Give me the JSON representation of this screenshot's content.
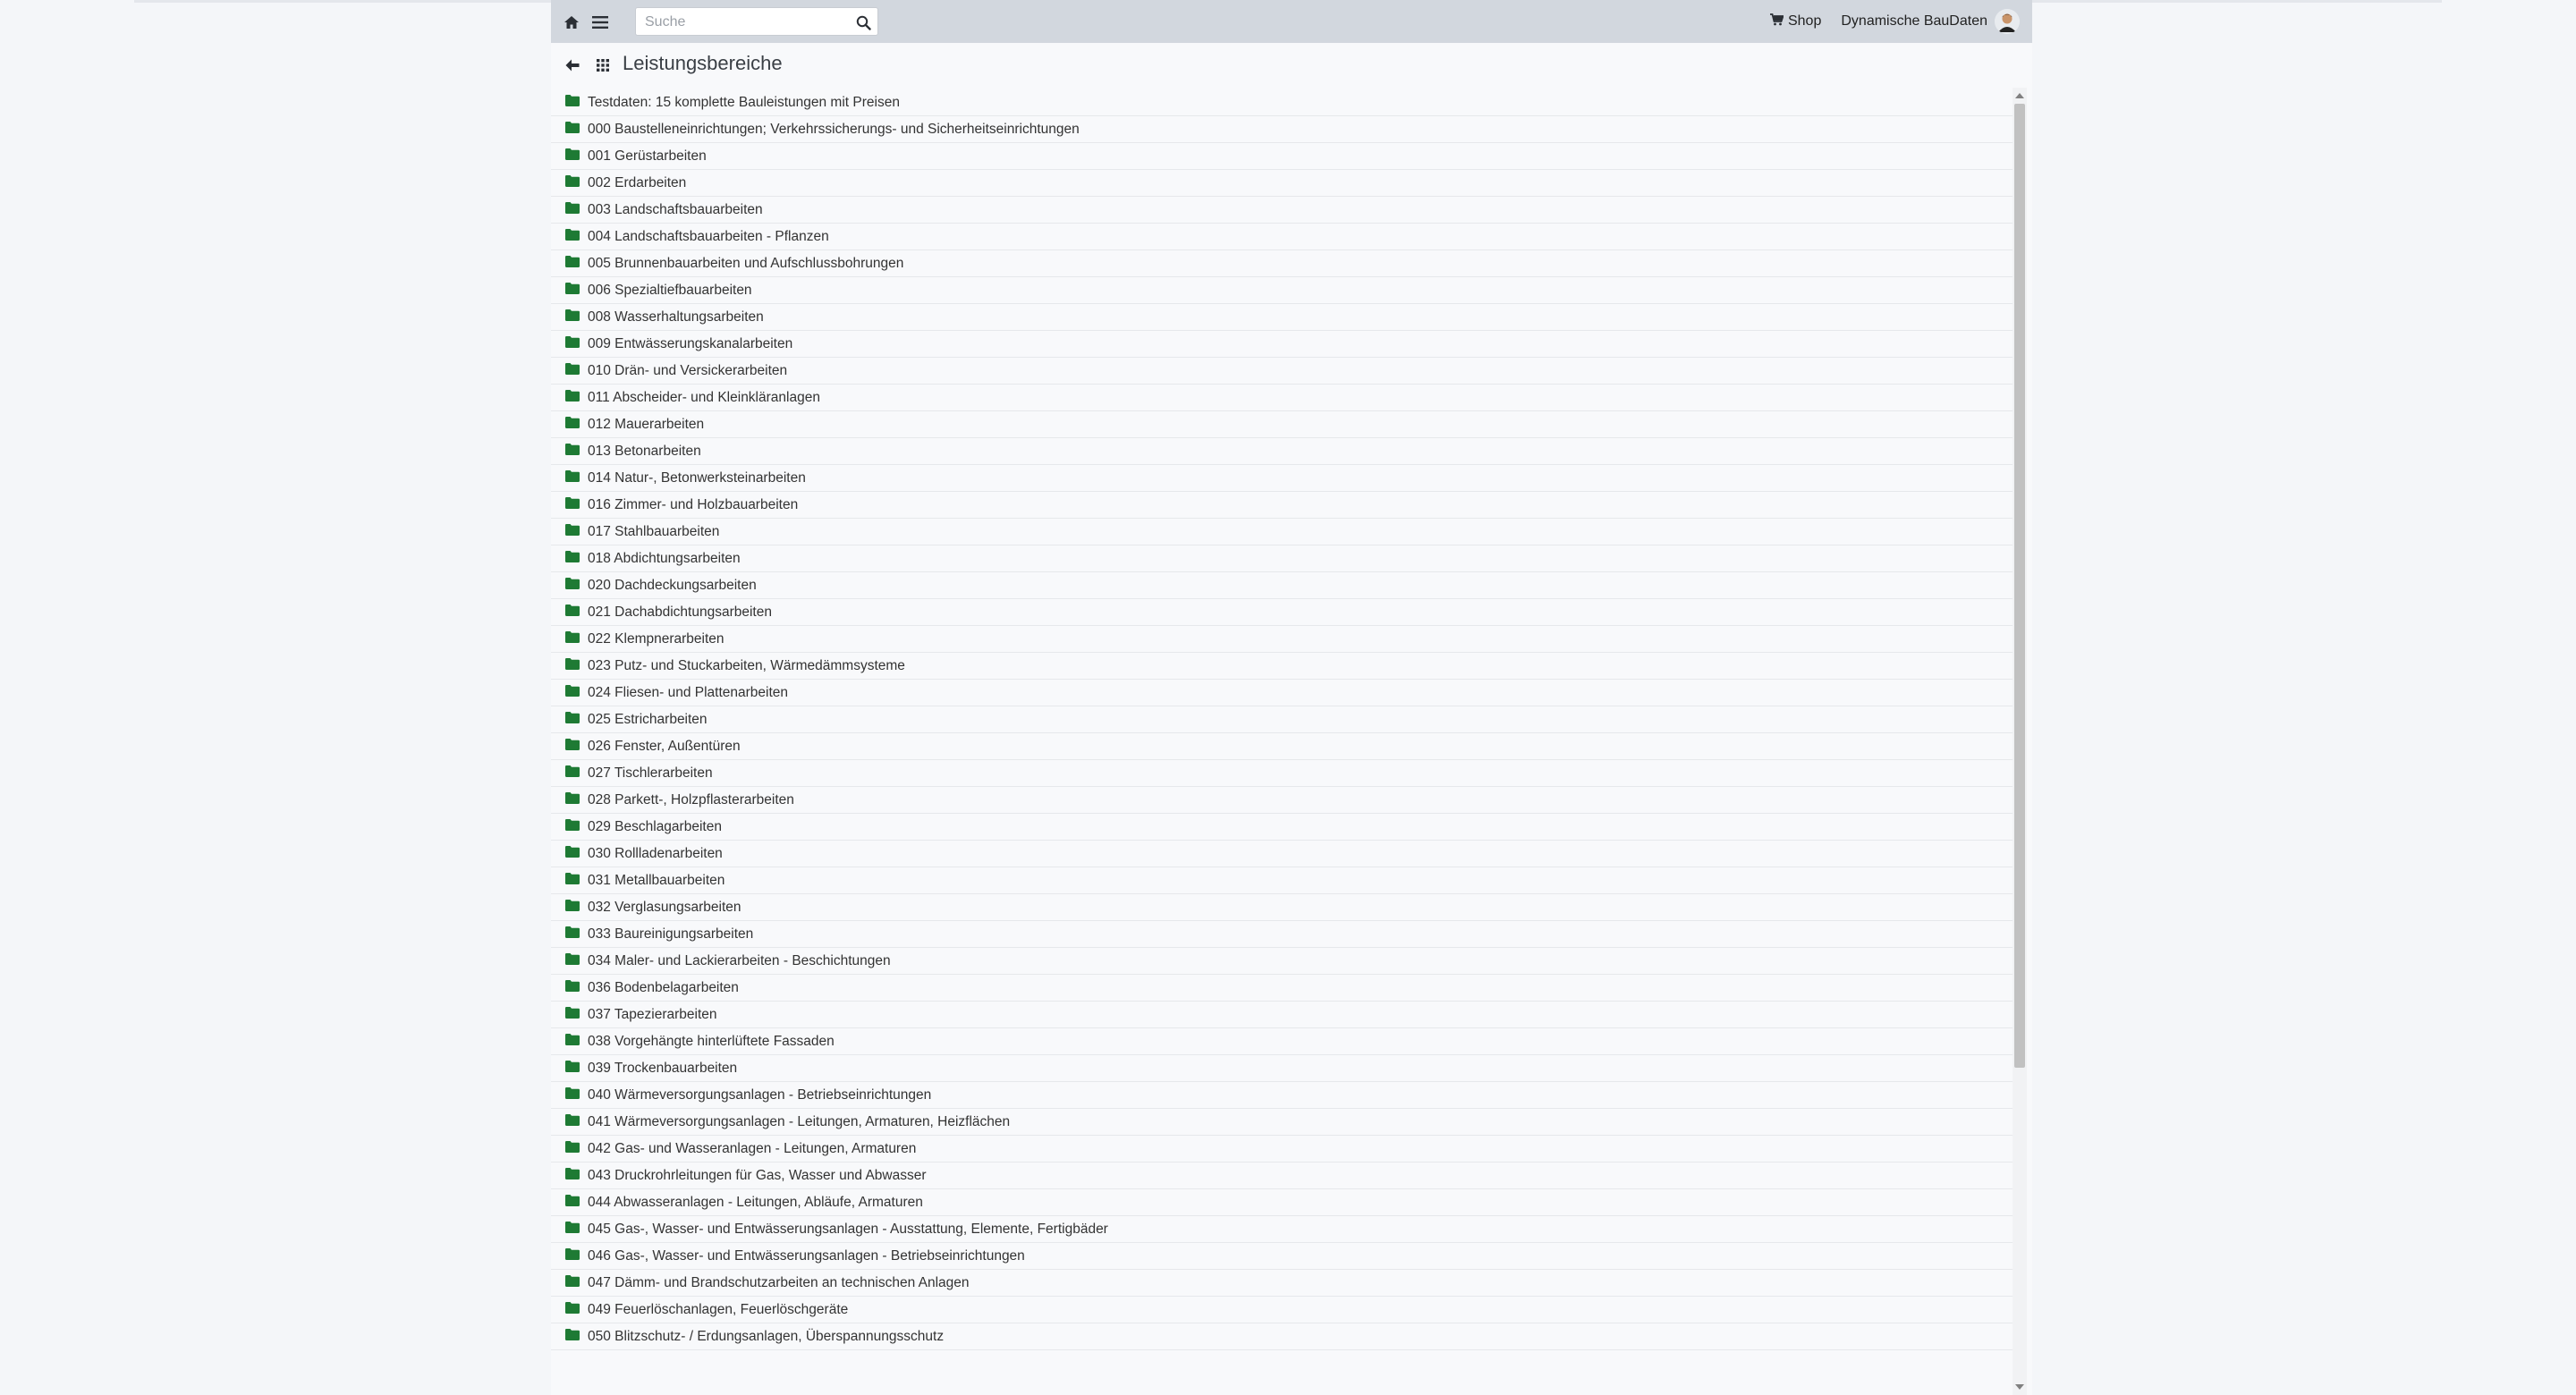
{
  "navbar": {
    "search_placeholder": "Suche",
    "shop_label": "Shop",
    "user_label": "Dynamische BauDaten"
  },
  "page": {
    "title": "Leistungsbereiche"
  },
  "colors": {
    "folder_icon": "#1e7a34",
    "navbar_bg": "#d2d7de"
  },
  "items": [
    "Testdaten: 15 komplette Bauleistungen mit Preisen",
    "000 Baustelleneinrichtungen; Verkehrssicherungs- und Sicherheitseinrichtungen",
    "001 Gerüstarbeiten",
    "002 Erdarbeiten",
    "003 Landschaftsbauarbeiten",
    "004 Landschaftsbauarbeiten - Pflanzen",
    "005 Brunnenbauarbeiten und Aufschlussbohrungen",
    "006 Spezialtiefbauarbeiten",
    "008 Wasserhaltungsarbeiten",
    "009 Entwässerungskanalarbeiten",
    "010 Drän- und Versickerarbeiten",
    "011 Abscheider- und Kleinkläranlagen",
    "012 Mauerarbeiten",
    "013 Betonarbeiten",
    "014 Natur-, Betonwerksteinarbeiten",
    "016 Zimmer- und Holzbauarbeiten",
    "017 Stahlbauarbeiten",
    "018 Abdichtungsarbeiten",
    "020 Dachdeckungsarbeiten",
    "021 Dachabdichtungsarbeiten",
    "022 Klempnerarbeiten",
    "023 Putz- und Stuckarbeiten, Wärmedämmsysteme",
    "024 Fliesen- und Plattenarbeiten",
    "025 Estricharbeiten",
    "026 Fenster, Außentüren",
    "027 Tischlerarbeiten",
    "028 Parkett-, Holzpflasterarbeiten",
    "029 Beschlagarbeiten",
    "030 Rollladenarbeiten",
    "031 Metallbauarbeiten",
    "032 Verglasungsarbeiten",
    "033 Baureinigungsarbeiten",
    "034 Maler- und Lackierarbeiten - Beschichtungen",
    "036 Bodenbelagarbeiten",
    "037 Tapezierarbeiten",
    "038 Vorgehängte hinterlüftete Fassaden",
    "039 Trockenbauarbeiten",
    "040 Wärmeversorgungsanlagen - Betriebseinrichtungen",
    "041 Wärmeversorgungsanlagen - Leitungen, Armaturen, Heizflächen",
    "042 Gas- und Wasseranlagen - Leitungen, Armaturen",
    "043 Druckrohrleitungen für Gas, Wasser und Abwasser",
    "044 Abwasseranlagen - Leitungen, Abläufe, Armaturen",
    "045 Gas-, Wasser- und Entwässerungsanlagen - Ausstattung, Elemente, Fertigbäder",
    "046 Gas-, Wasser- und Entwässerungsanlagen - Betriebseinrichtungen",
    "047 Dämm- und Brandschutzarbeiten an technischen Anlagen",
    "049 Feuerlöschanlagen, Feuerlöschgeräte",
    "050 Blitzschutz- / Erdungsanlagen, Überspannungsschutz"
  ]
}
